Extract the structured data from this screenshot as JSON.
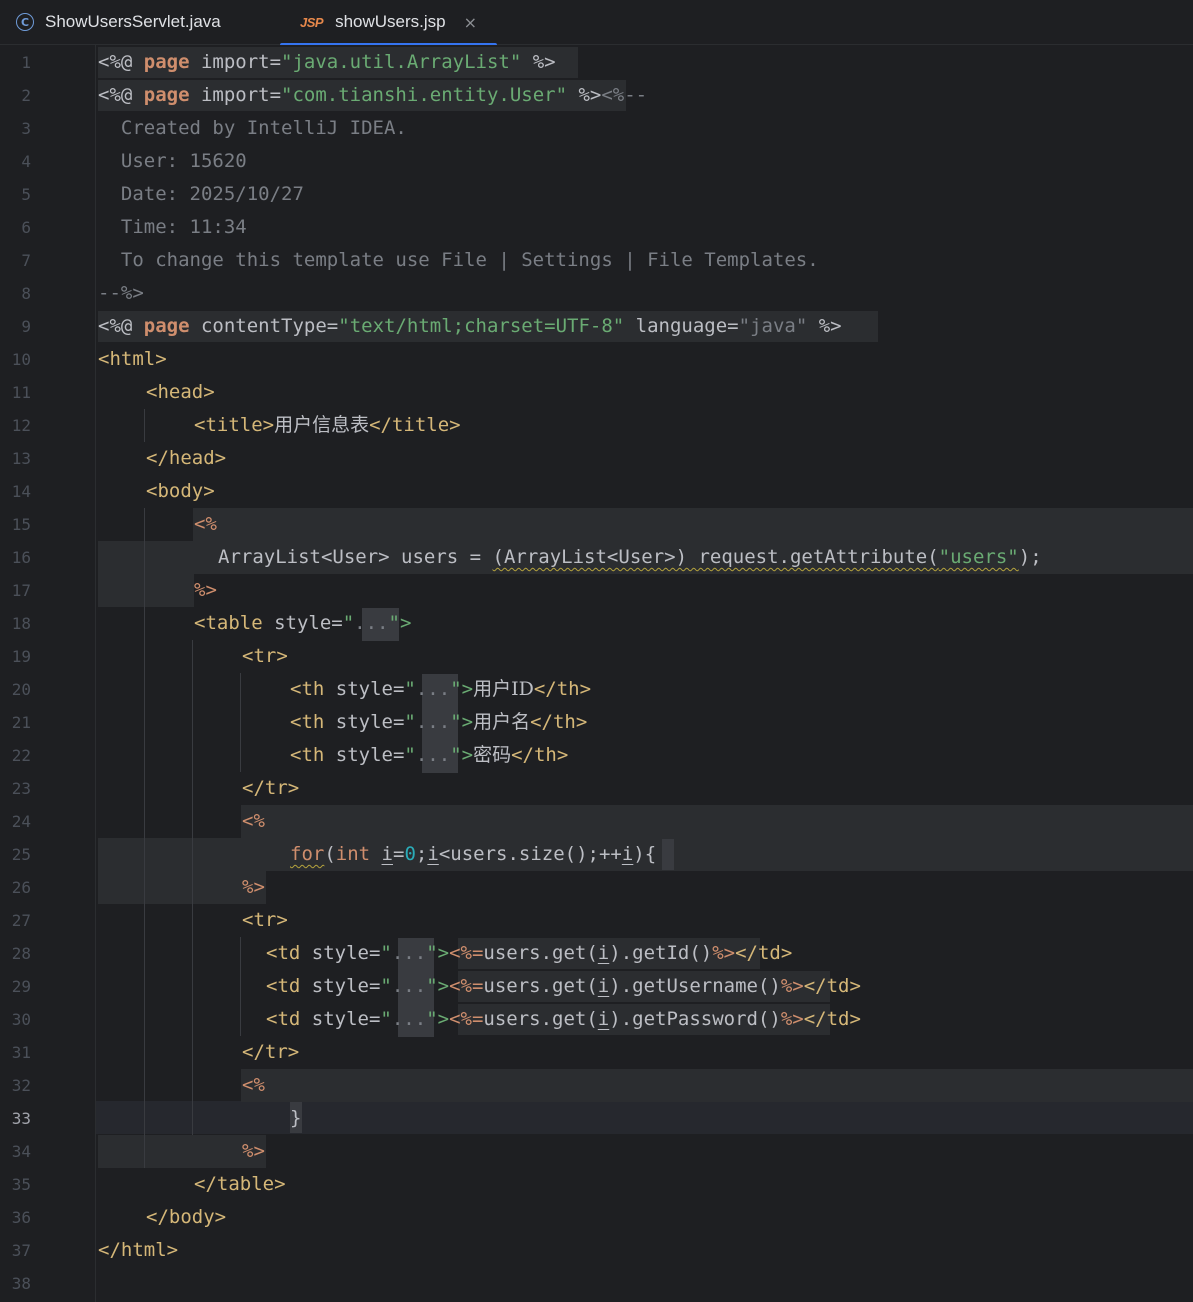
{
  "tabs": [
    {
      "label": "ShowUsersServlet.java",
      "icon": "java-class-icon",
      "active": false
    },
    {
      "label": "showUsers.jsp",
      "icon": "jsp-file-icon",
      "icon_text": "JSP",
      "active": true,
      "close": "×"
    }
  ],
  "editor": {
    "current_line": 33,
    "line_numbers": [
      "1",
      "2",
      "3",
      "4",
      "5",
      "6",
      "7",
      "8",
      "9",
      "10",
      "11",
      "12",
      "13",
      "14",
      "15",
      "16",
      "17",
      "18",
      "19",
      "20",
      "21",
      "22",
      "23",
      "24",
      "25",
      "26",
      "27",
      "28",
      "29",
      "30",
      "31",
      "32",
      "33",
      "34",
      "35",
      "36",
      "37",
      "38"
    ],
    "lines": {
      "l1": [
        "<%@ ",
        "page",
        " import=",
        "\"java.util.ArrayList\"",
        " %>"
      ],
      "l2": [
        "<%@ ",
        "page",
        " import=",
        "\"com.tianshi.entity.User\"",
        " %>",
        "<%--"
      ],
      "l3": "  Created by IntelliJ IDEA.",
      "l4": "  User: 15620",
      "l5": "  Date: 2025/10/27",
      "l6": "  Time: 11:34",
      "l7": "  To change this template use File | Settings | File Templates.",
      "l8": "--%>",
      "l9": [
        "<%@ ",
        "page",
        " contentType=",
        "\"text/html;charset=UTF-8\"",
        " language=",
        "\"java\"",
        " %>"
      ],
      "l10": "<html>",
      "l11": "<head>",
      "l12": [
        "<title>",
        "用户信息表",
        "</title>"
      ],
      "l13": "</head>",
      "l14": "<body>",
      "l15": "<%",
      "l16": [
        "ArrayList<User> users = ",
        "(ArrayList<User>) request.getAttribute(",
        "\"users\"",
        ");"
      ],
      "l17": "%>",
      "l18": [
        "<table ",
        "style=",
        "\"",
        "...",
        "\">"
      ],
      "l19": "<tr>",
      "l20": [
        "<th ",
        "style=",
        "\"",
        "...",
        "\">",
        "用户ID",
        "</th>"
      ],
      "l21": [
        "<th ",
        "style=",
        "\"",
        "...",
        "\">",
        "用户名",
        "</th>"
      ],
      "l22": [
        "<th ",
        "style=",
        "\"",
        "...",
        "\">",
        "密码",
        "</th>"
      ],
      "l23": "</tr>",
      "l24": "<%",
      "l25": [
        "for",
        "(",
        "int ",
        "i",
        "=",
        "0",
        ";",
        "i",
        "<users.size();++",
        "i",
        "){"
      ],
      "l26": "%>",
      "l27": "<tr>",
      "l28": [
        "<td ",
        "style=",
        "\"",
        "...",
        "\">",
        "<%=",
        "users.get(",
        "i",
        ").getId()",
        "%>",
        "</td>"
      ],
      "l29": [
        "<td ",
        "style=",
        "\"",
        "...",
        "\">",
        "<%=",
        "users.get(",
        "i",
        ").getUsername()",
        "%>",
        "</td>"
      ],
      "l30": [
        "<td ",
        "style=",
        "\"",
        "...",
        "\">",
        "<%=",
        "users.get(",
        "i",
        ").getPassword()",
        "%>",
        "</td>"
      ],
      "l31": "</tr>",
      "l32": "<%",
      "l33": "}",
      "l34": "%>",
      "l35": "</table>",
      "l36": "</body>",
      "l37": "</html>",
      "l38": ""
    }
  }
}
